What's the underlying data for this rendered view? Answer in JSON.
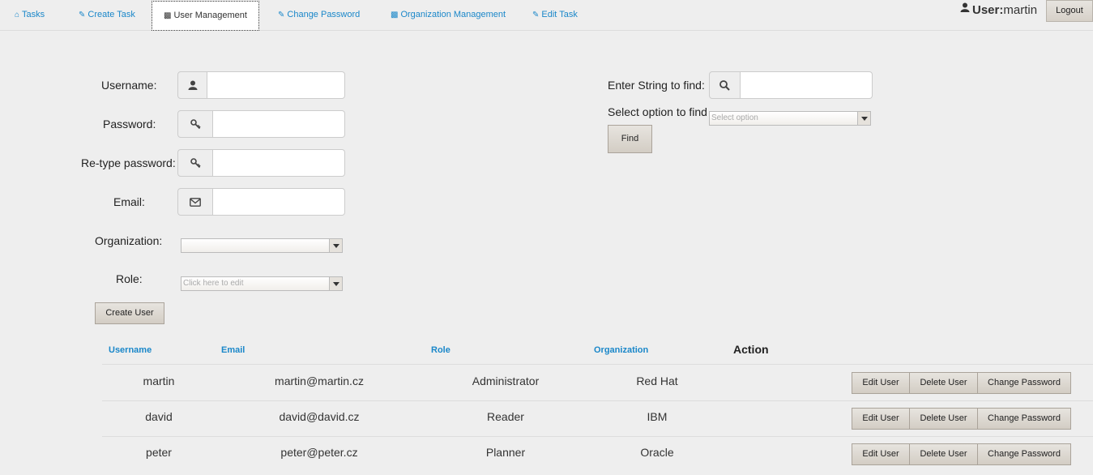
{
  "nav": {
    "tabs": [
      {
        "label": "Tasks",
        "icon": "home-icon"
      },
      {
        "label": "Create Task",
        "icon": "pencil-icon"
      },
      {
        "label": "User Management",
        "icon": "book-icon"
      },
      {
        "label": "Change Password",
        "icon": "pencil-icon"
      },
      {
        "label": "Organization Management",
        "icon": "book-icon"
      },
      {
        "label": "Edit Task",
        "icon": "pencil-icon"
      }
    ],
    "user_prefix": "User:",
    "username": "martin",
    "logout": "Logout"
  },
  "form": {
    "username_label": "Username:",
    "password_label": "Password:",
    "retype_label": "Re-type password:",
    "email_label": "Email:",
    "organization_label": "Organization:",
    "organization_value": "",
    "role_label": "Role:",
    "role_placeholder": "Click here to edit",
    "create_button": "Create User"
  },
  "search": {
    "find_label": "Enter String to find:",
    "option_label": "Select option to find",
    "option_placeholder": "Select option",
    "find_button": "Find"
  },
  "table": {
    "headers": [
      "Username",
      "Email",
      "Role",
      "Organization",
      "Action"
    ],
    "rows": [
      {
        "username": "martin",
        "email": "martin@martin.cz",
        "role": "Administrator",
        "organization": "Red Hat"
      },
      {
        "username": "david",
        "email": "david@david.cz",
        "role": "Reader",
        "organization": "IBM"
      },
      {
        "username": "peter",
        "email": "peter@peter.cz",
        "role": "Planner",
        "organization": "Oracle"
      }
    ],
    "actions": [
      "Edit User",
      "Delete User",
      "Change Password"
    ]
  }
}
